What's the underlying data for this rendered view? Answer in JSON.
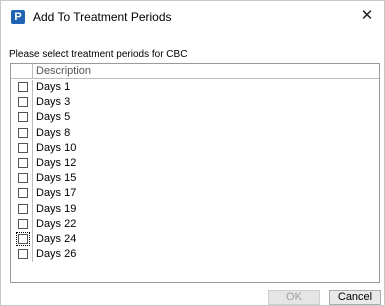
{
  "window": {
    "title": "Add To Treatment Periods",
    "app_icon_letter": "P",
    "close_glyph": "✕"
  },
  "instruction": "Please select treatment periods for CBC",
  "list": {
    "column_header": "Description",
    "items": [
      {
        "label": "Days 1",
        "checked": false
      },
      {
        "label": "Days 3",
        "checked": false
      },
      {
        "label": "Days 5",
        "checked": false
      },
      {
        "label": "Days 8",
        "checked": false
      },
      {
        "label": "Days 10",
        "checked": false
      },
      {
        "label": "Days 12",
        "checked": false
      },
      {
        "label": "Days 15",
        "checked": false
      },
      {
        "label": "Days 17",
        "checked": false
      },
      {
        "label": "Days 19",
        "checked": false
      },
      {
        "label": "Days 22",
        "checked": false
      },
      {
        "label": "Days 24",
        "checked": false,
        "focused": true
      },
      {
        "label": "Days 26",
        "checked": false
      }
    ]
  },
  "buttons": {
    "ok_label": "OK",
    "ok_enabled": false,
    "cancel_label": "Cancel"
  },
  "colors": {
    "app_icon": "#1f63b5"
  }
}
